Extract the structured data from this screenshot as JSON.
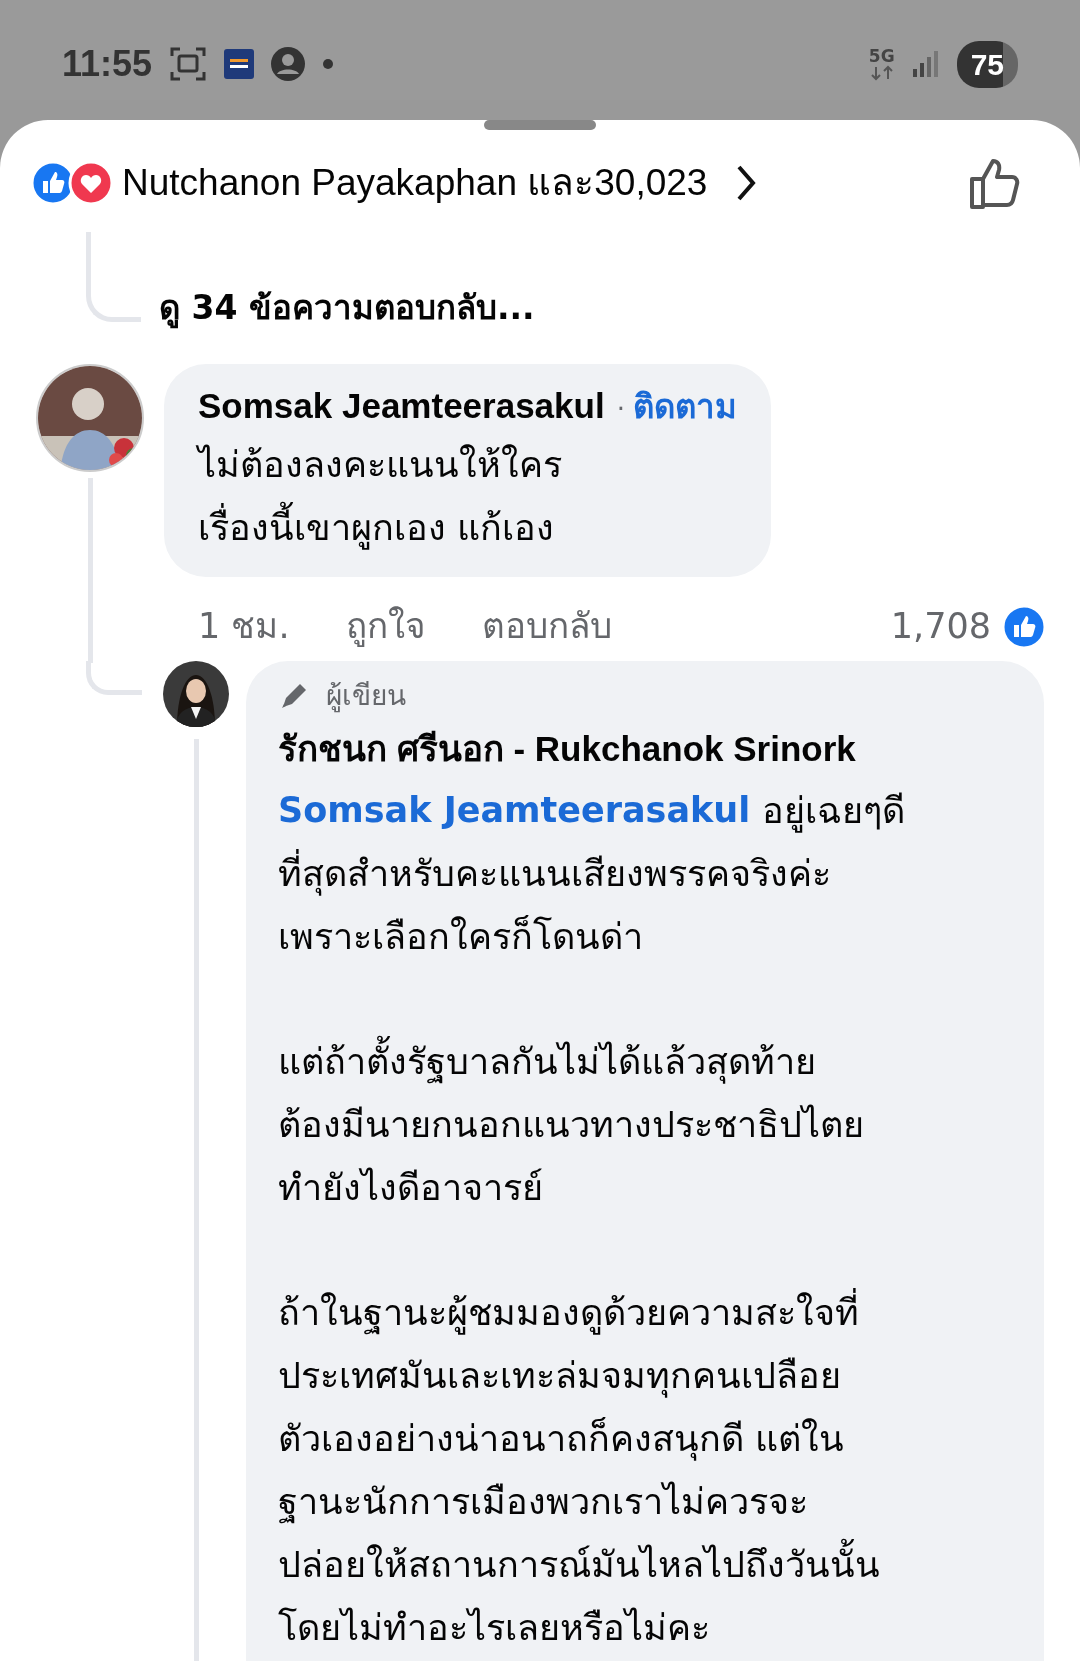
{
  "status_bar": {
    "time": "11:55",
    "network": "5G",
    "battery": "75"
  },
  "reactions_header": {
    "label": "Nutchanon Payakaphan และ30,023"
  },
  "view_replies": "ดู 34 ข้อความตอบกลับ...",
  "comment": {
    "author": "Somsak Jeamteerasakul",
    "separator": "·",
    "follow": "ติดตาม",
    "lines": [
      "ไม่ต้องลงคะแนนให้ใคร",
      "เรื่องนี้เขาผูกเอง แก้เอง"
    ],
    "time": "1 ชม.",
    "like": "ถูกใจ",
    "reply": "ตอบกลับ",
    "reaction_count": "1,708"
  },
  "reply": {
    "badge": "ผู้เขียน",
    "author": "รักชนก ศรีนอก - Rukchanok Srinork",
    "mention": "Somsak Jeamteerasakul",
    "paragraphs": [
      [
        "อยู่เฉยๆดี",
        "ที่สุดสำหรับคะแนนเสียงพรรคจริงค่ะ",
        "เพราะเลือกใครก็โดนด่า"
      ],
      [
        "แต่ถ้าตั้งรัฐบาลกันไม่ได้แล้วสุดท้าย",
        "ต้องมีนายกนอกแนวทางประชาธิปไตย",
        "ทำยังไงดีอาจารย์"
      ],
      [
        "ถ้าในฐานะผู้ชมมองดูด้วยความสะใจที่",
        "ประเทศมันเละเทะล่มจมทุกคนเปลือย",
        "ตัวเองอย่างน่าอนาถก็คงสนุกดี แต่ใน",
        "ฐานะนักการเมืองพวกเราไม่ควรจะ",
        "ปล่อยให้สถานการณ์มันไหลไปถึงวันนั้น",
        "โดยไม่ทำอะไรเลยหรือไม่คะ"
      ]
    ]
  }
}
